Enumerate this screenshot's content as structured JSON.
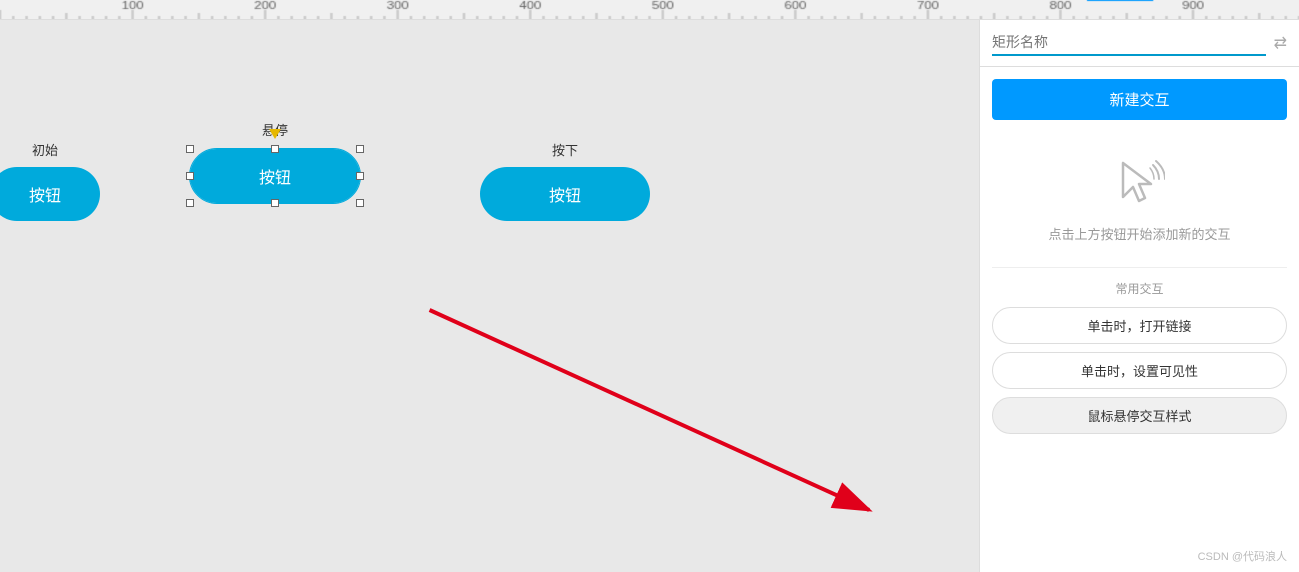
{
  "ruler": {
    "ticks": [
      200,
      300,
      400,
      500,
      600,
      700
    ]
  },
  "canvas": {
    "background": "#e8e8e8",
    "states": [
      {
        "id": "initial",
        "label": "初始",
        "buttonText": "按钮",
        "selected": false
      },
      {
        "id": "hover",
        "label": "悬停",
        "buttonText": "按钮",
        "selected": true
      },
      {
        "id": "pressed",
        "label": "按下",
        "buttonText": "按钮",
        "selected": false
      }
    ]
  },
  "panel": {
    "nameInputPlaceholder": "矩形名称",
    "newInteractionLabel": "新建交互",
    "hintText": "点击上方按钮开始添加新的交互",
    "commonTitle": "常用交互",
    "interactions": [
      {
        "label": "单击时，打开链接"
      },
      {
        "label": "单击时，设置可见性"
      },
      {
        "label": "鼠标悬停交互样式"
      }
    ],
    "footer": "CSDN @代码浪人"
  },
  "icons": {
    "cursor": "cursor-icon",
    "settings": "⇄"
  },
  "colors": {
    "buttonBlue": "#00aadc",
    "accentBlue": "#0099ff",
    "arrowRed": "#e0001a"
  }
}
